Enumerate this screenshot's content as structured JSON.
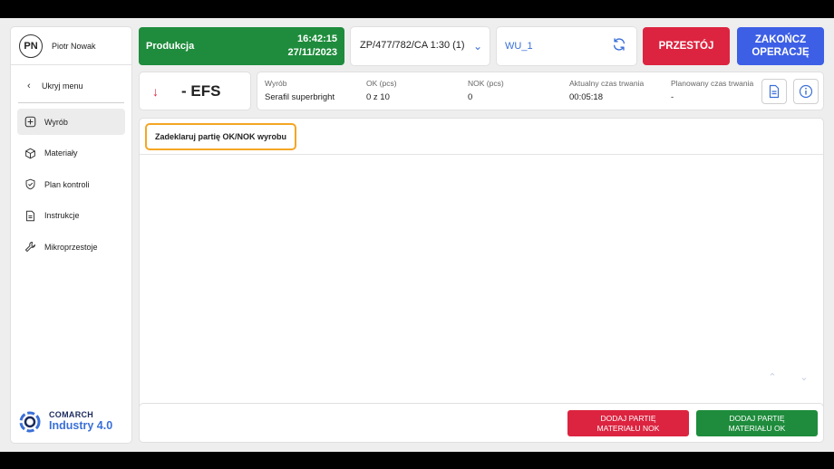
{
  "user": {
    "initials": "PN",
    "name": "Piotr Nowak"
  },
  "sidebar": {
    "hide_menu": "Ukryj menu",
    "items": [
      {
        "label": "Wyrób",
        "icon": "plus-square-icon",
        "active": true
      },
      {
        "label": "Materiały",
        "icon": "cube-icon"
      },
      {
        "label": "Plan kontroli",
        "icon": "shield-check-icon"
      },
      {
        "label": "Instrukcje",
        "icon": "document-icon"
      },
      {
        "label": "Mikroprzestoje",
        "icon": "wrench-icon"
      }
    ],
    "brand_line1": "COMARCH",
    "brand_line2": "Industry 4.0"
  },
  "header": {
    "status_label": "Produkcja",
    "time": "16:42:15",
    "date": "27/11/2023",
    "order": "ZP/477/782/CA 1:30 (1)",
    "workstation": "WU_1",
    "downtime_button": "PRZESTÓJ",
    "finish_button": "ZAKOŃCZ\nOPERACJĘ"
  },
  "operation": {
    "code": "- EFS"
  },
  "info": {
    "product_label": "Wyrób",
    "product_value": "Serafil superbright",
    "ok_label": "OK (pcs)",
    "ok_value": "0 z 10",
    "nok_label": "NOK (pcs)",
    "nok_value": "0",
    "current_time_label": "Aktualny czas trwania",
    "current_time_value": "00:05:18",
    "planned_time_label": "Planowany czas trwania",
    "planned_time_value": "-"
  },
  "main": {
    "tab_label": "Zadeklaruj partię OK/NOK wyrobu"
  },
  "bottom": {
    "add_nok_button": "DODAJ PARTIĘ\nMATERIAŁU NOK",
    "add_ok_button": "DODAJ PARTIĘ\nMATERIAŁU OK"
  },
  "colors": {
    "green": "#1e8c3c",
    "red": "#dc2440",
    "blue": "#3d5fe6",
    "accent_orange": "#f5a623",
    "link_blue": "#3a6fd8"
  }
}
